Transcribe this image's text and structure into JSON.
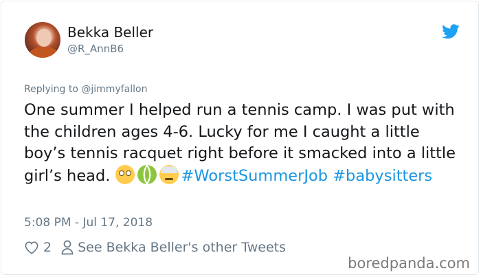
{
  "tweet": {
    "author_name": "Bekka Beller",
    "author_handle": "@R_AnnB6",
    "reply_prefix": "Replying to ",
    "reply_mention": "@jimmyfallon",
    "text_main": "One summer I helped run a tennis camp. I was put with the children ages 4-6. Lucky for me I caught a little boy’s tennis racquet right before it smacked into a little girl’s head. ",
    "emojis": [
      "flushed-face",
      "tennis-ball",
      "face-with-head-bandage"
    ],
    "hashtag_1": "#WorstSummerJob",
    "hashtag_2": "#babysitters",
    "timestamp": "5:08 PM - Jul 17, 2018",
    "like_count": "2",
    "see_other_tweets": "See Bekka Beller's other Tweets"
  },
  "icons": {
    "platform": "twitter-bird-icon",
    "like": "heart-icon",
    "profile": "person-icon"
  },
  "colors": {
    "hashtag": "#1b95e0",
    "twitter_blue": "#1da1f2",
    "muted": "#657786"
  },
  "watermark": "boredpanda.com"
}
